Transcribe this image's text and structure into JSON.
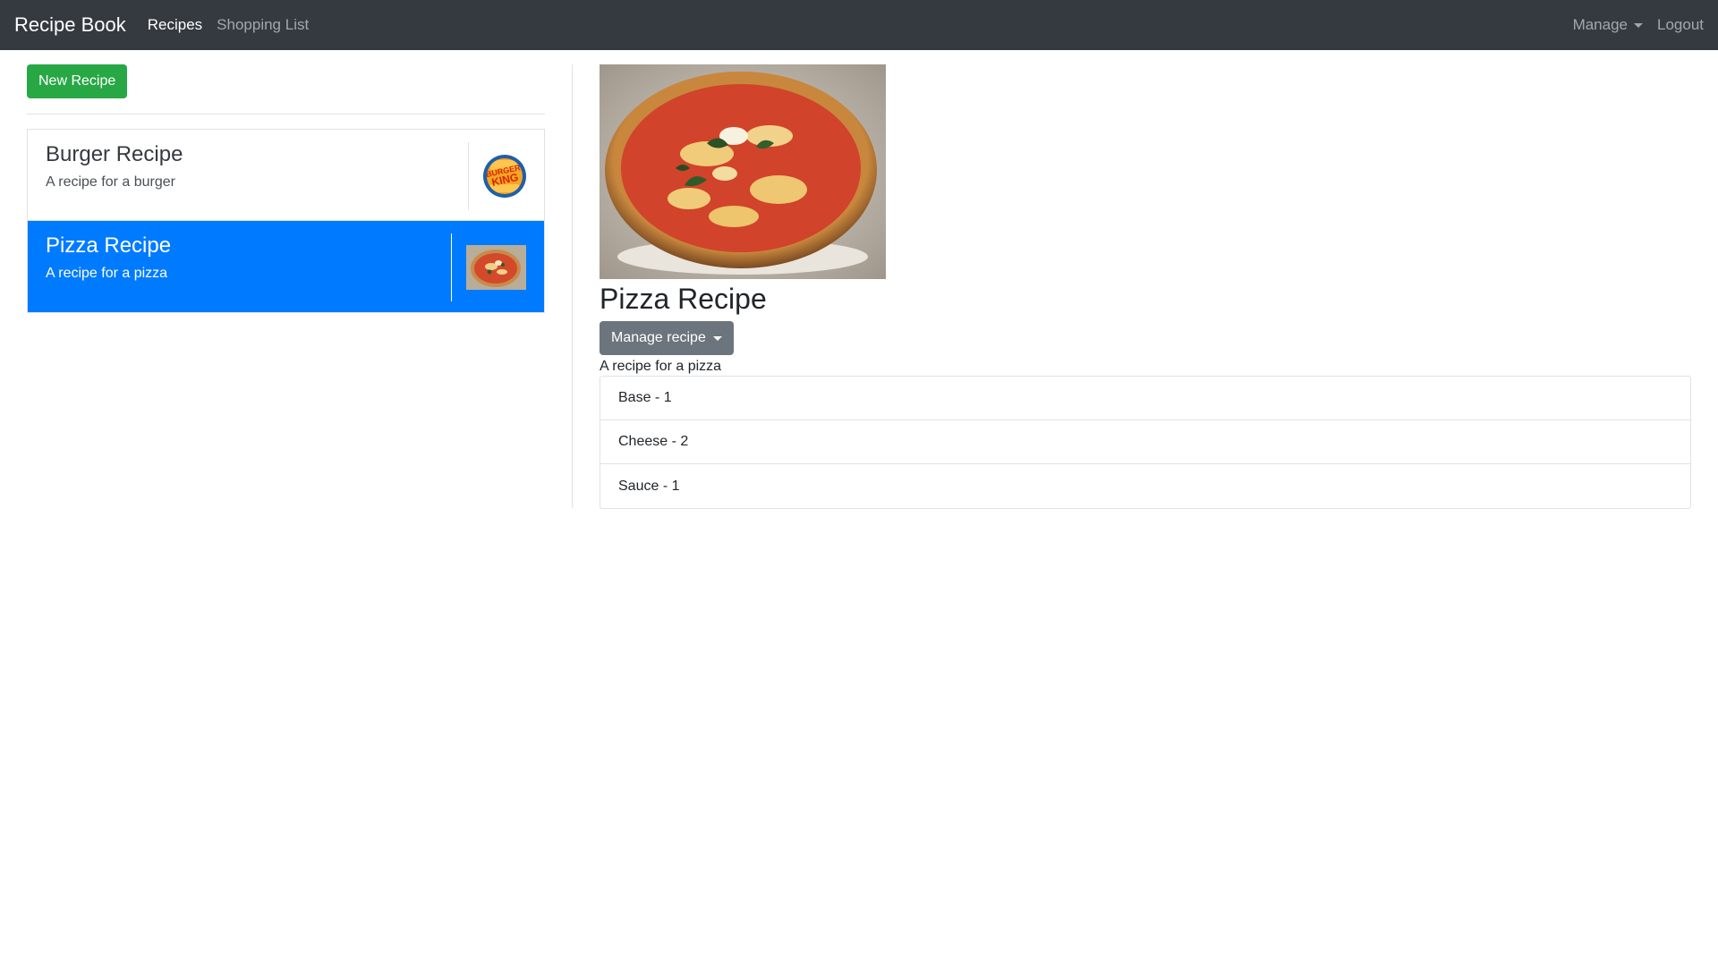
{
  "navbar": {
    "brand": "Recipe Book",
    "links": [
      {
        "label": "Recipes"
      },
      {
        "label": "Shopping List"
      }
    ],
    "manage_label": "Manage",
    "logout_label": "Logout"
  },
  "sidebar": {
    "new_button_label": "New Recipe",
    "recipes": [
      {
        "name": "Burger Recipe",
        "description": "A recipe for a burger",
        "logo_text_1": "BURGER",
        "logo_text_2": "KING"
      },
      {
        "name": "Pizza Recipe",
        "description": "A recipe for a pizza"
      }
    ]
  },
  "detail": {
    "title": "Pizza Recipe",
    "manage_button_label": "Manage recipe",
    "description": "A recipe for a pizza",
    "ingredients": [
      {
        "text": "Base - 1"
      },
      {
        "text": "Cheese - 2"
      },
      {
        "text": "Sauce - 1"
      }
    ]
  },
  "colors": {
    "navbar": "#343a40",
    "success": "#28a745",
    "primary": "#007bff",
    "secondary": "#6c757d"
  }
}
